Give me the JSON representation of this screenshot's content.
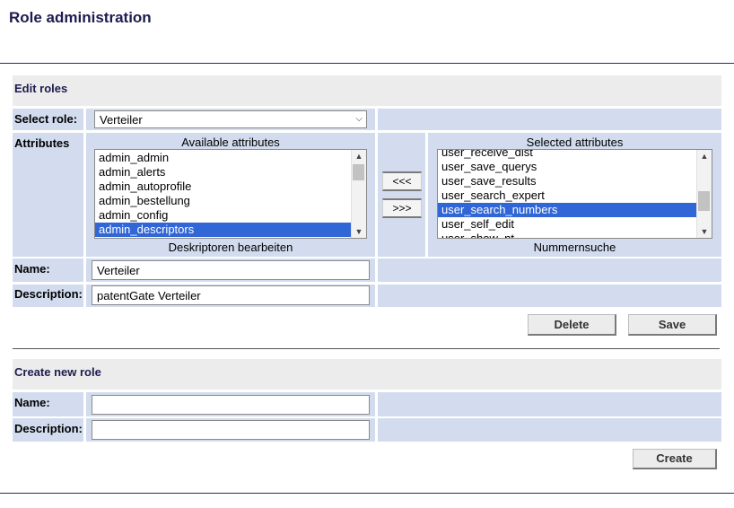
{
  "page": {
    "title": "Role administration"
  },
  "edit": {
    "heading": "Edit roles",
    "select_label": "Select role:",
    "selected_role": "Verteiler",
    "attributes_label": "Attributes",
    "available": {
      "title": "Available attributes",
      "items": [
        "admin_admin",
        "admin_alerts",
        "admin_autoprofile",
        "admin_bestellung",
        "admin_config",
        "admin_descriptors"
      ],
      "selected_index": 5,
      "description": "Deskriptoren bearbeiten"
    },
    "selected": {
      "title": "Selected attributes",
      "items": [
        "user_receive_dist",
        "user_save_querys",
        "user_save_results",
        "user_search_expert",
        "user_search_numbers",
        "user_self_edit",
        "user_show_nt"
      ],
      "selected_index": 4,
      "description": "Nummernsuche"
    },
    "move_left_label": "<<<",
    "move_right_label": ">>>",
    "name_label": "Name:",
    "name_value": "Verteiler",
    "desc_label": "Description:",
    "desc_value": "patentGate Verteiler",
    "delete_label": "Delete",
    "save_label": "Save"
  },
  "create": {
    "heading": "Create new role",
    "name_label": "Name:",
    "name_value": "",
    "desc_label": "Description:",
    "desc_value": "",
    "create_label": "Create"
  },
  "colors": {
    "heading": "#1c1c4e",
    "cell": "#d2dcee",
    "section": "#ececec",
    "selection": "#3166d6"
  },
  "icons": {
    "select_arrow": "chevron-down-icon",
    "scroll_up": "scroll-up-icon",
    "scroll_down": "scroll-down-icon"
  }
}
